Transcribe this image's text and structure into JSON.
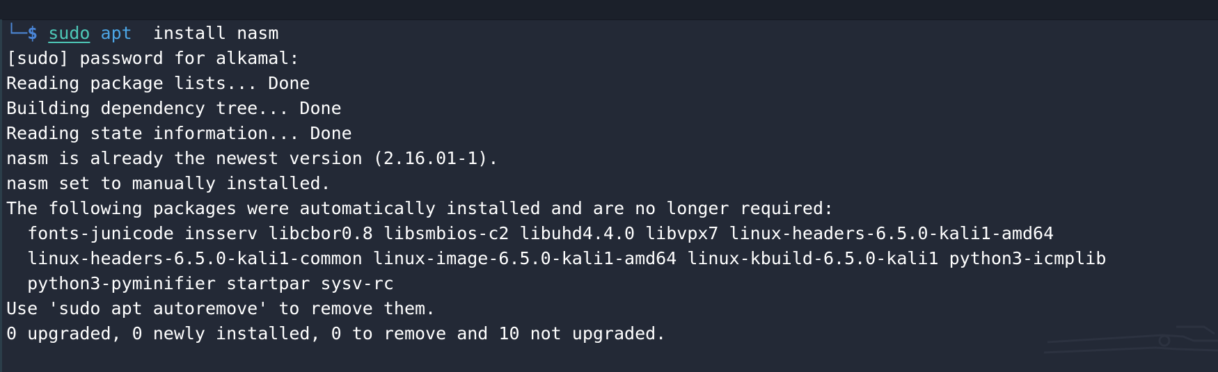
{
  "prompt": {
    "corner": "└─",
    "dollar": "$",
    "cmd_sudo": "sudo",
    "cmd_apt": "apt",
    "cmd_rest": "  install nasm"
  },
  "output": [
    "[sudo] password for alkamal:",
    "Reading package lists... Done",
    "Building dependency tree... Done",
    "Reading state information... Done",
    "nasm is already the newest version (2.16.01-1).",
    "nasm set to manually installed.",
    "The following packages were automatically installed and are no longer required:",
    "  fonts-junicode insserv libcbor0.8 libsmbios-c2 libuhd4.4.0 libvpx7 linux-headers-6.5.0-kali1-amd64",
    "  linux-headers-6.5.0-kali1-common linux-image-6.5.0-kali1-amd64 linux-kbuild-6.5.0-kali1 python3-icmplib",
    "  python3-pyminifier startpar sysv-rc",
    "Use 'sudo apt autoremove' to remove them.",
    "0 upgraded, 0 newly installed, 0 to remove and 10 not upgraded."
  ],
  "colors": {
    "background": "#232936",
    "text": "#ffffff",
    "prompt": "#4a86d8",
    "sudo": "#4ec9b8",
    "apt": "#4ca6e6"
  }
}
